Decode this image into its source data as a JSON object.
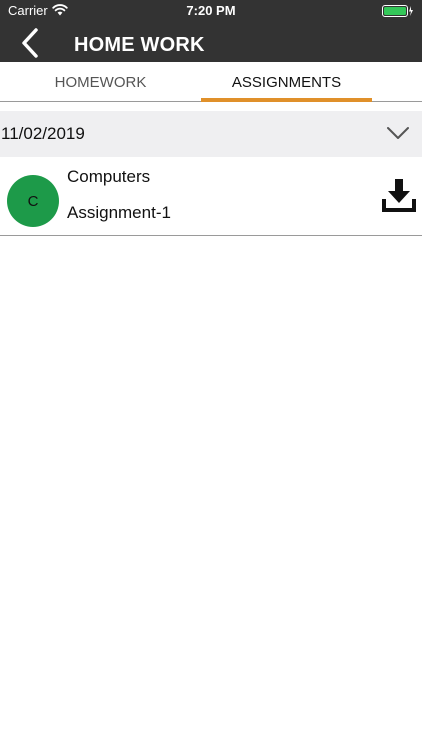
{
  "status_bar": {
    "carrier": "Carrier",
    "time": "7:20 PM",
    "battery_color": "#34c759"
  },
  "nav": {
    "title": "HOME WORK",
    "background": "#333333"
  },
  "tabs": [
    {
      "label": "HOMEWORK",
      "selected": false
    },
    {
      "label": "ASSIGNMENTS",
      "selected": true
    }
  ],
  "accent_color": "#e0902a",
  "date_group": {
    "date": "11/02/2019",
    "icon": "chevron-down-icon"
  },
  "assignments": [
    {
      "avatar_letter": "C",
      "avatar_color": "#1d9a49",
      "subject": "Computers",
      "title": "Assignment-1",
      "action_icon": "download-icon"
    }
  ]
}
